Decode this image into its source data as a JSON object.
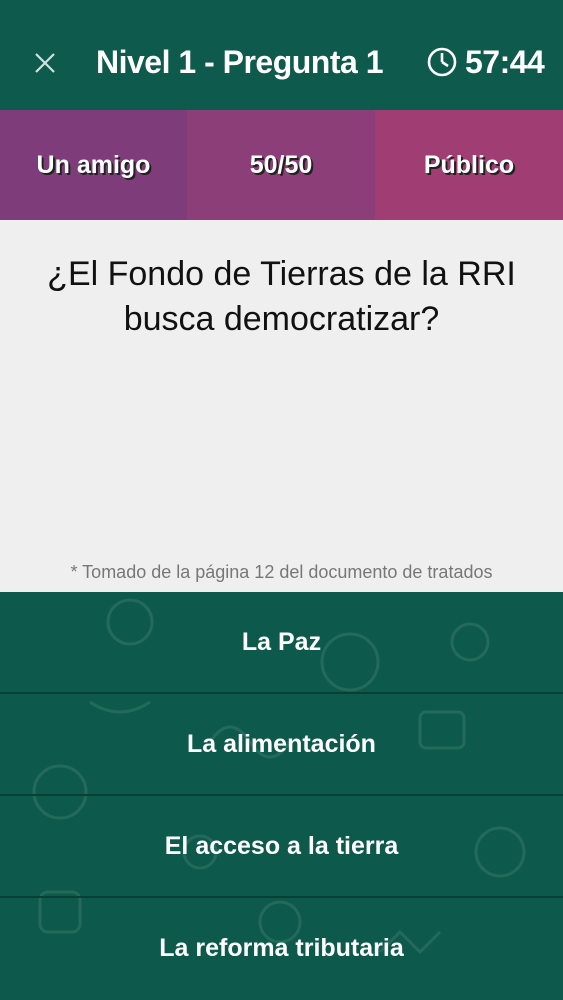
{
  "header": {
    "title": "Nivel 1 - Pregunta 1",
    "timer": "57:44",
    "close_icon": "close-icon",
    "timer_icon": "clock-icon"
  },
  "lifelines": [
    {
      "label": "Un amigo"
    },
    {
      "label": "50/50"
    },
    {
      "label": "Público"
    }
  ],
  "question": {
    "text": "¿El Fondo de Tierras de la RRI busca democratizar?",
    "source_note": "* Tomado de la página 12 del documento de tratados"
  },
  "answers": [
    {
      "label": "La Paz"
    },
    {
      "label": "La alimentación"
    },
    {
      "label": "El acceso a la tierra"
    },
    {
      "label": "La reforma tributaria"
    }
  ],
  "colors": {
    "header_bg": "#0e5a4d",
    "lifeline_friend": "#7e3d7a",
    "lifeline_5050": "#8c3e78",
    "lifeline_public": "#a03d72",
    "question_bg": "#f0eff0",
    "answer_bg": "#0d5a4c"
  }
}
